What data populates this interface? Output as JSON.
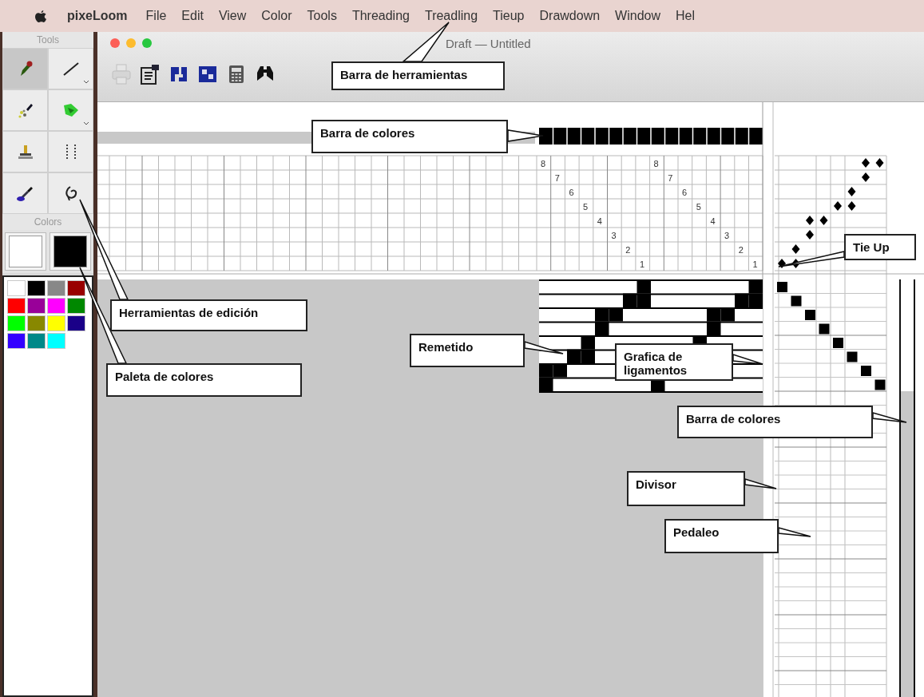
{
  "menu_bar": {
    "app": "pixeLoom",
    "items": [
      "File",
      "Edit",
      "View",
      "Color",
      "Tools",
      "Threading",
      "Treadling",
      "Tieup",
      "Drawdown",
      "Window",
      "Hel"
    ]
  },
  "tools_panel": {
    "title": "Tools",
    "tools": [
      {
        "kind": "pencil",
        "selected": true,
        "has_menu": false
      },
      {
        "kind": "line",
        "selected": false,
        "has_menu": true
      },
      {
        "kind": "spray",
        "selected": false,
        "has_menu": false
      },
      {
        "kind": "fill",
        "selected": false,
        "has_menu": true
      },
      {
        "kind": "stamp",
        "selected": false,
        "has_menu": false
      },
      {
        "kind": "dotted",
        "selected": false,
        "has_menu": false
      },
      {
        "kind": "dropper",
        "selected": false,
        "has_menu": false
      },
      {
        "kind": "lasso",
        "selected": false,
        "has_menu": false
      }
    ],
    "colors_title": "Colors",
    "wells": [
      {
        "color": "#ffffff"
      },
      {
        "color": "#000000"
      }
    ],
    "palette": [
      {
        "color": "#ffffff"
      },
      {
        "color": "#000000"
      },
      {
        "color": "#888888"
      },
      {
        "color": "#990000"
      },
      {
        "color": "#ff0000"
      },
      {
        "color": "#990099"
      },
      {
        "color": "#ff00ff"
      },
      {
        "color": "#008800"
      },
      {
        "color": "#00ff00"
      },
      {
        "color": "#888800"
      },
      {
        "color": "#ffff00"
      },
      {
        "color": "#1a0088"
      },
      {
        "color": "#3300ff"
      },
      {
        "color": "#008888"
      },
      {
        "color": "#00ffff"
      }
    ]
  },
  "window": {
    "title": "Draft — Untitled",
    "toolbar": [
      {
        "kind": "print",
        "disabled": true
      },
      {
        "kind": "inspector",
        "disabled": false
      },
      {
        "kind": "threading",
        "disabled": false
      },
      {
        "kind": "treadling",
        "disabled": false
      },
      {
        "kind": "calculator",
        "disabled": false
      },
      {
        "kind": "find",
        "disabled": false
      }
    ]
  },
  "threading": {
    "numbers": [
      "8",
      "7",
      "6",
      "5",
      "4",
      "3",
      "2",
      "1",
      "8",
      "7",
      "6",
      "5",
      "4",
      "3",
      "2",
      "1"
    ]
  },
  "callouts": [
    {
      "text": "Barra de herramientas"
    },
    {
      "text": "Barra de colores"
    },
    {
      "text": "Tie Up"
    },
    {
      "text": "Herramientas de edición"
    },
    {
      "text": "Paleta de colores"
    },
    {
      "text": "Remetido"
    },
    {
      "text": "Grafica de ligamentos"
    },
    {
      "text": "Barra de colores"
    },
    {
      "text": "Divisor"
    },
    {
      "text": "Pedaleo"
    }
  ]
}
